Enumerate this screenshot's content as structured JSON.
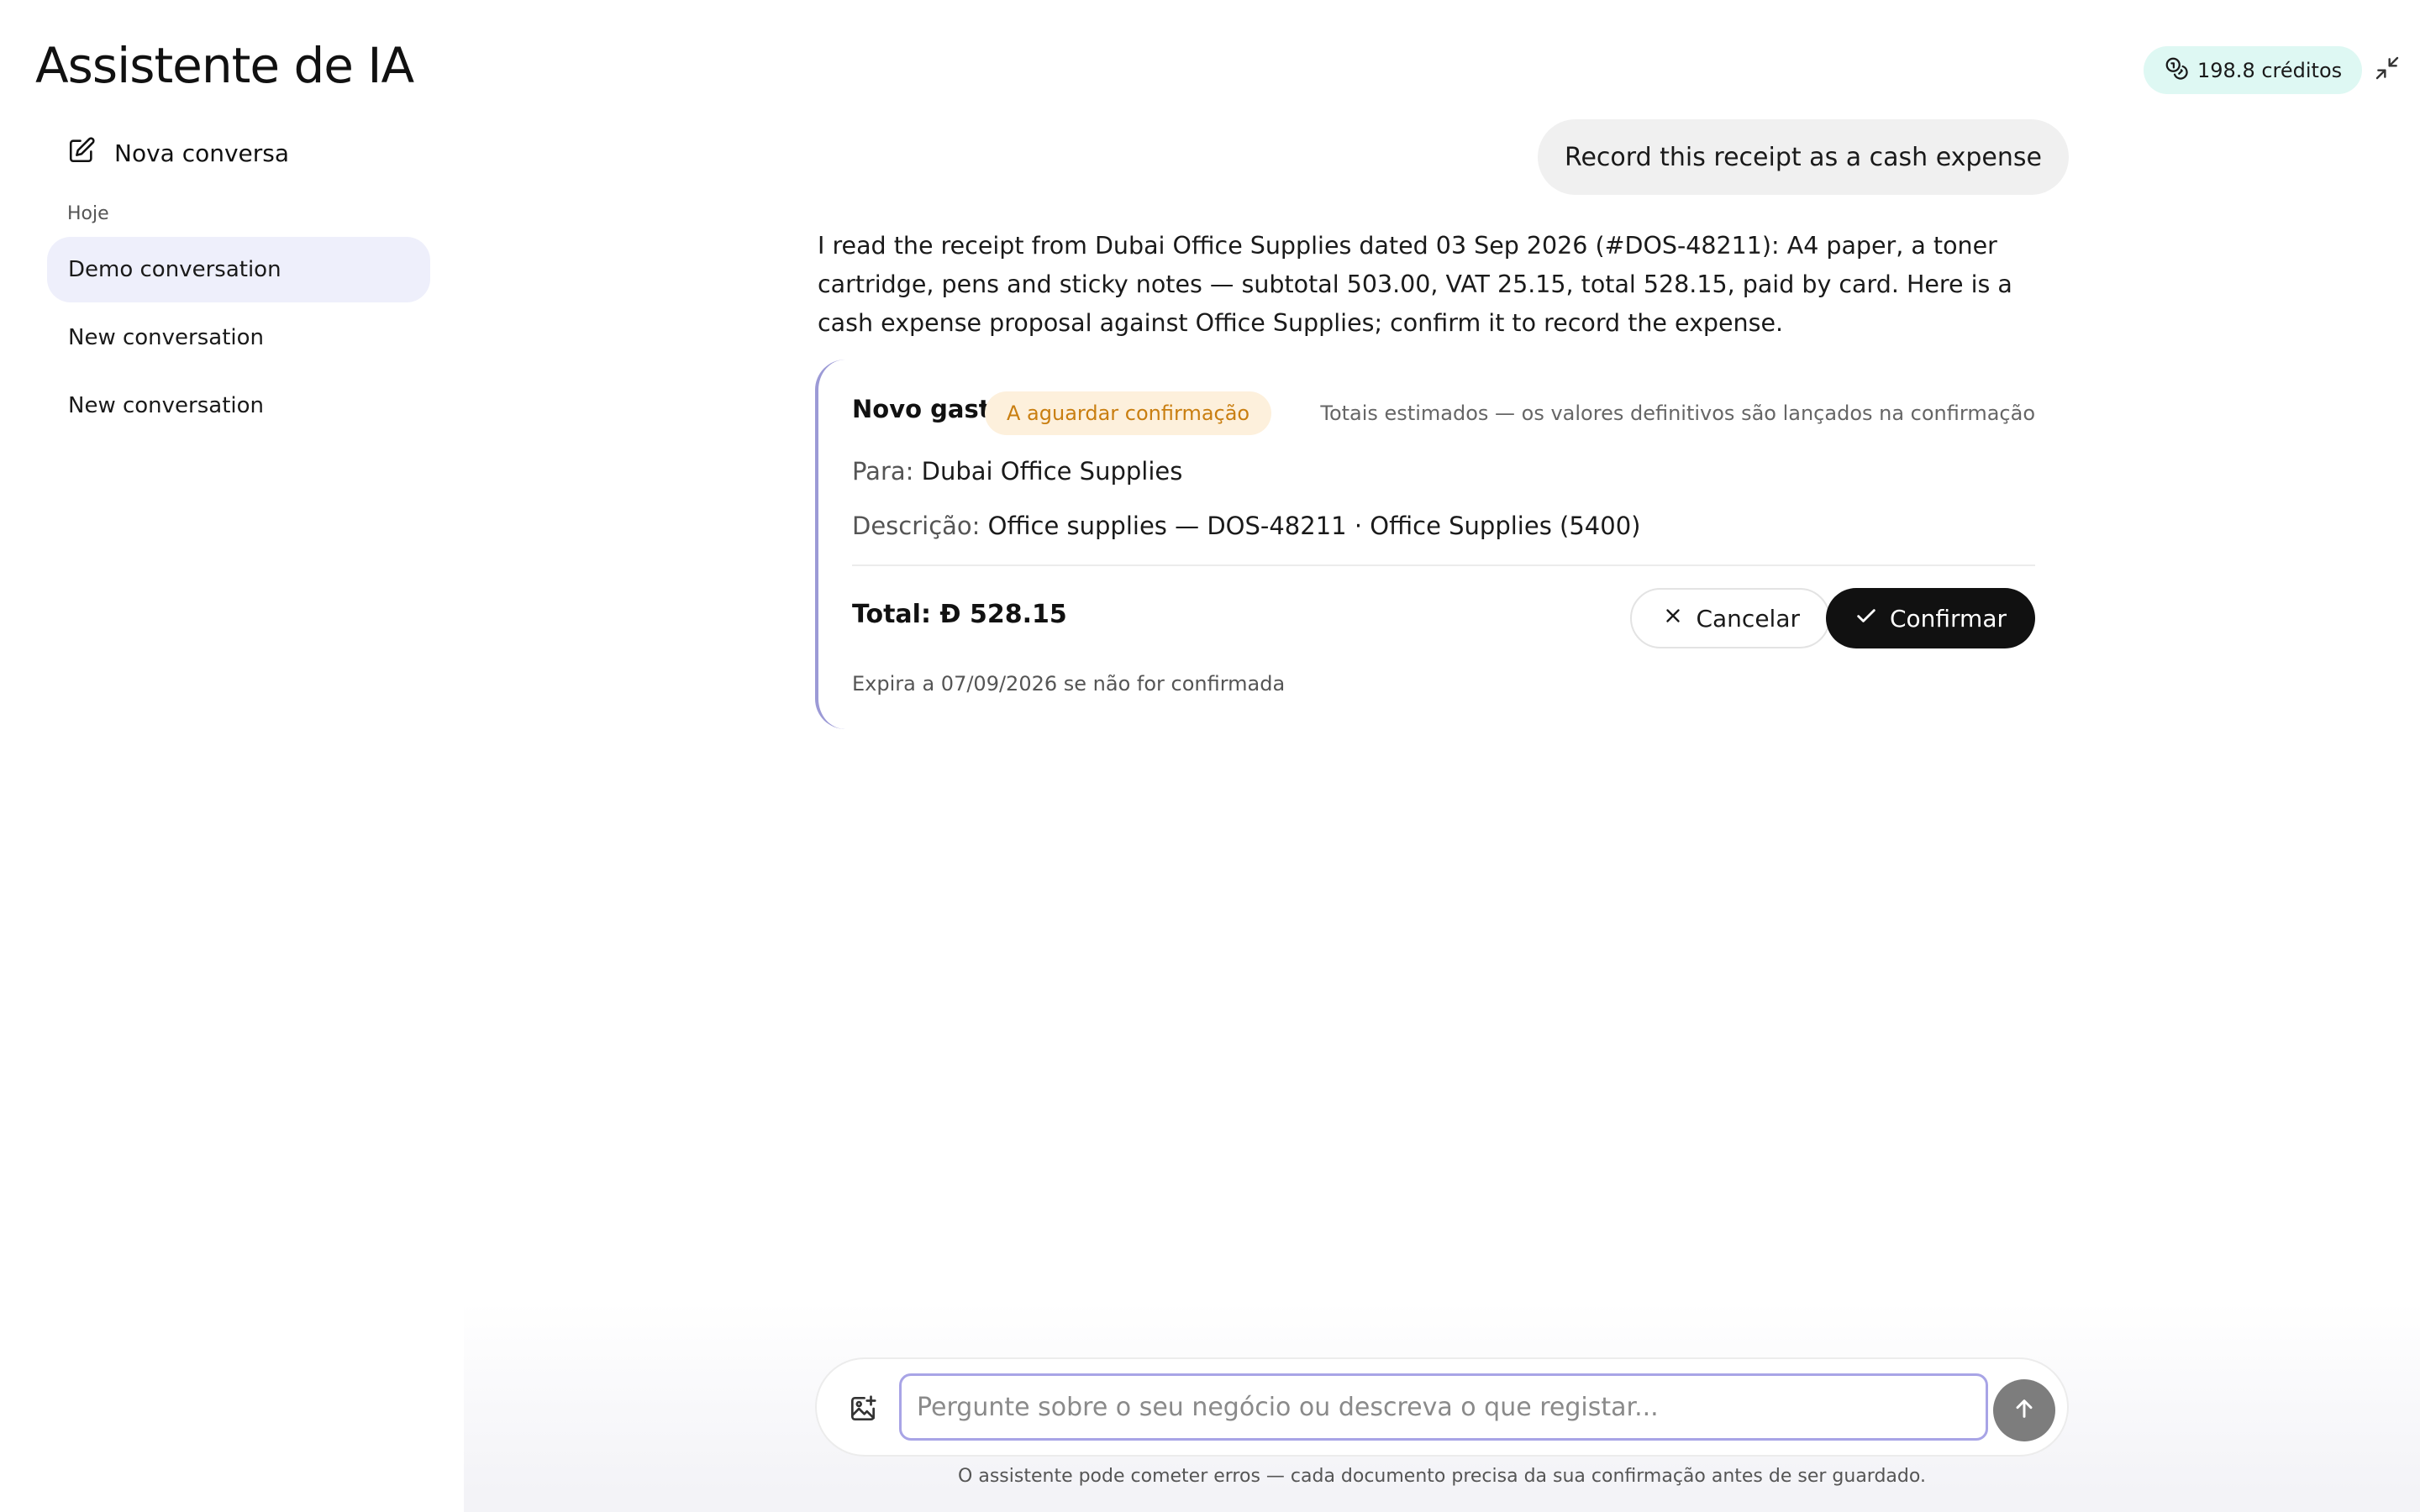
{
  "header": {
    "title": "Assistente de IA",
    "credits": "198.8 créditos"
  },
  "sidebar": {
    "new_conversation": "Nova conversa",
    "section_label": "Hoje",
    "items": [
      {
        "label": "Demo conversation",
        "active": true
      },
      {
        "label": "New conversation",
        "active": false
      },
      {
        "label": "New conversation",
        "active": false
      }
    ]
  },
  "chat": {
    "user_message": "Record this receipt as a cash expense",
    "assistant_message": "I read the receipt from Dubai Office Supplies dated 03 Sep 2026 (#DOS-48211): A4 paper, a toner cartridge, pens and sticky notes — subtotal 503.00, VAT 25.15, total 528.15, paid by card. Here is a cash expense proposal against Office Supplies; confirm it to record the expense."
  },
  "proposal": {
    "title": "Novo gasto",
    "status": "A aguardar confirmação",
    "estimate_note": "Totais estimados — os valores definitivos são lançados na confirmação",
    "to_label": "Para:",
    "to_value": "Dubai Office Supplies",
    "description_label": "Descrição:",
    "description_value": "Office supplies — DOS-48211 · Office Supplies (5400)",
    "total_label": "Total:",
    "currency_symbol": "Ð",
    "total_value": "528.15",
    "cancel_label": "Cancelar",
    "confirm_label": "Confirmar",
    "expiry": "Expira a 07/09/2026 se não for confirmada"
  },
  "composer": {
    "placeholder": "Pergunte sobre o seu negócio ou descreva o que registar...",
    "value": "",
    "disclaimer": "O assistente pode cometer erros — cada documento precisa da sua confirmação antes de ser guardado."
  },
  "colors": {
    "credits_bg": "#def8f3",
    "active_item_bg": "#eeeffb",
    "badge_bg": "#fdf0dc",
    "badge_text": "#c97e10",
    "card_accent": "#9c9ad6",
    "input_border": "#a8a4e6",
    "confirm_bg": "#111111",
    "send_bg": "#7d7d7d"
  },
  "icons": [
    "coins-icon",
    "minimize-icon",
    "edit-icon",
    "close-icon",
    "check-icon",
    "image-add-icon",
    "arrow-up-icon"
  ]
}
